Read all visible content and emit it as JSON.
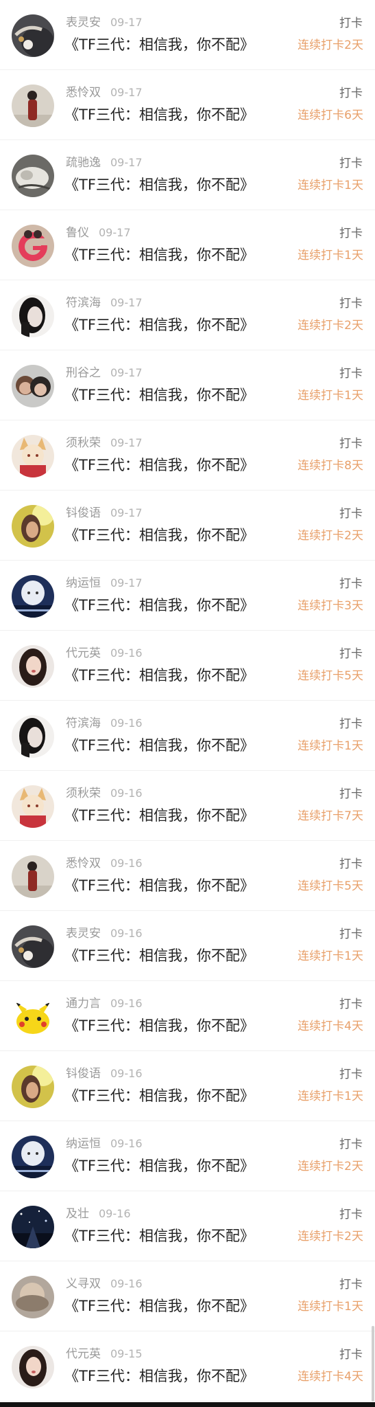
{
  "colors": {
    "streak": "#e8a06a",
    "action": "#666666",
    "name": "#9a9a9a",
    "title": "#222222"
  },
  "entries": [
    {
      "name": "表灵安",
      "date": "09-17",
      "title": "《TF三代：相信我，你不配》",
      "action": "打卡",
      "streak": "连续打卡2天",
      "avatar": "pearl-hair-photo"
    },
    {
      "name": "悉怜双",
      "date": "09-17",
      "title": "《TF三代：相信我，你不配》",
      "action": "打卡",
      "streak": "连续打卡6天",
      "avatar": "standing-person-photo"
    },
    {
      "name": "疏驰逸",
      "date": "09-17",
      "title": "《TF三代：相信我，你不配》",
      "action": "打卡",
      "streak": "连续打卡1天",
      "avatar": "cat-photo"
    },
    {
      "name": "鲁仪",
      "date": "09-17",
      "title": "《TF三代：相信我，你不配》",
      "action": "打卡",
      "streak": "连续打卡1天",
      "avatar": "letter-g-cartoon"
    },
    {
      "name": "符滨海",
      "date": "09-17",
      "title": "《TF三代：相信我，你不配》",
      "action": "打卡",
      "streak": "连续打卡2天",
      "avatar": "dark-portrait-photo"
    },
    {
      "name": "刑谷之",
      "date": "09-17",
      "title": "《TF三代：相信我，你不配》",
      "action": "打卡",
      "streak": "连续打卡1天",
      "avatar": "couple-photo"
    },
    {
      "name": "须秋荣",
      "date": "09-17",
      "title": "《TF三代：相信我，你不配》",
      "action": "打卡",
      "streak": "连续打卡8天",
      "avatar": "anime-fox-girl"
    },
    {
      "name": "钭俊语",
      "date": "09-17",
      "title": "《TF三代：相信我，你不配》",
      "action": "打卡",
      "streak": "连续打卡2天",
      "avatar": "sunlit-portrait-photo"
    },
    {
      "name": "纳运恒",
      "date": "09-17",
      "title": "《TF三代：相信我，你不配》",
      "action": "打卡",
      "streak": "连续打卡3天",
      "avatar": "blue-portrait-photo"
    },
    {
      "name": "代元英",
      "date": "09-16",
      "title": "《TF三代：相信我，你不配》",
      "action": "打卡",
      "streak": "连续打卡5天",
      "avatar": "long-hair-portrait-photo"
    },
    {
      "name": "符滨海",
      "date": "09-16",
      "title": "《TF三代：相信我，你不配》",
      "action": "打卡",
      "streak": "连续打卡1天",
      "avatar": "dark-portrait-photo"
    },
    {
      "name": "须秋荣",
      "date": "09-16",
      "title": "《TF三代：相信我，你不配》",
      "action": "打卡",
      "streak": "连续打卡7天",
      "avatar": "anime-fox-girl"
    },
    {
      "name": "悉怜双",
      "date": "09-16",
      "title": "《TF三代：相信我，你不配》",
      "action": "打卡",
      "streak": "连续打卡5天",
      "avatar": "standing-person-photo"
    },
    {
      "name": "表灵安",
      "date": "09-16",
      "title": "《TF三代：相信我，你不配》",
      "action": "打卡",
      "streak": "连续打卡1天",
      "avatar": "pearl-hair-photo"
    },
    {
      "name": "通力言",
      "date": "09-16",
      "title": "《TF三代：相信我，你不配》",
      "action": "打卡",
      "streak": "连续打卡4天",
      "avatar": "pikachu-cartoon"
    },
    {
      "name": "钭俊语",
      "date": "09-16",
      "title": "《TF三代：相信我，你不配》",
      "action": "打卡",
      "streak": "连续打卡1天",
      "avatar": "sunlit-portrait-photo"
    },
    {
      "name": "纳运恒",
      "date": "09-16",
      "title": "《TF三代：相信我，你不配》",
      "action": "打卡",
      "streak": "连续打卡2天",
      "avatar": "blue-portrait-photo"
    },
    {
      "name": "及壮",
      "date": "09-16",
      "title": "《TF三代：相信我，你不配》",
      "action": "打卡",
      "streak": "连续打卡2天",
      "avatar": "starry-night-photo"
    },
    {
      "name": "义寻双",
      "date": "09-16",
      "title": "《TF三代：相信我，你不配》",
      "action": "打卡",
      "streak": "连续打卡1天",
      "avatar": "blurry-portrait-photo"
    },
    {
      "name": "代元英",
      "date": "09-15",
      "title": "《TF三代：相信我，你不配》",
      "action": "打卡",
      "streak": "连续打卡4天",
      "avatar": "long-hair-portrait-photo"
    }
  ]
}
